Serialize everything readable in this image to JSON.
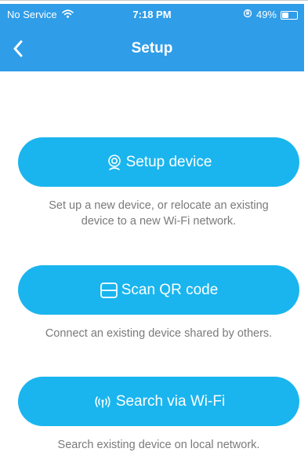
{
  "status_bar": {
    "carrier": "No Service",
    "time": "7:18 PM",
    "battery_percent": "49%",
    "battery_level": 0.49
  },
  "nav": {
    "title": "Setup"
  },
  "actions": [
    {
      "label": "Setup device",
      "icon": "webcam-icon",
      "description": "Set up a new device, or relocate an existing device to a new Wi-Fi network."
    },
    {
      "label": "Scan QR code",
      "icon": "qr-scan-icon",
      "description": "Connect an existing device shared by others."
    },
    {
      "label": "Search via Wi-Fi",
      "icon": "wifi-broadcast-icon",
      "description": "Search existing device on local network."
    }
  ],
  "colors": {
    "header": "#2f9de8",
    "button": "#1ab5ee",
    "description_text": "#7a7a7a"
  }
}
